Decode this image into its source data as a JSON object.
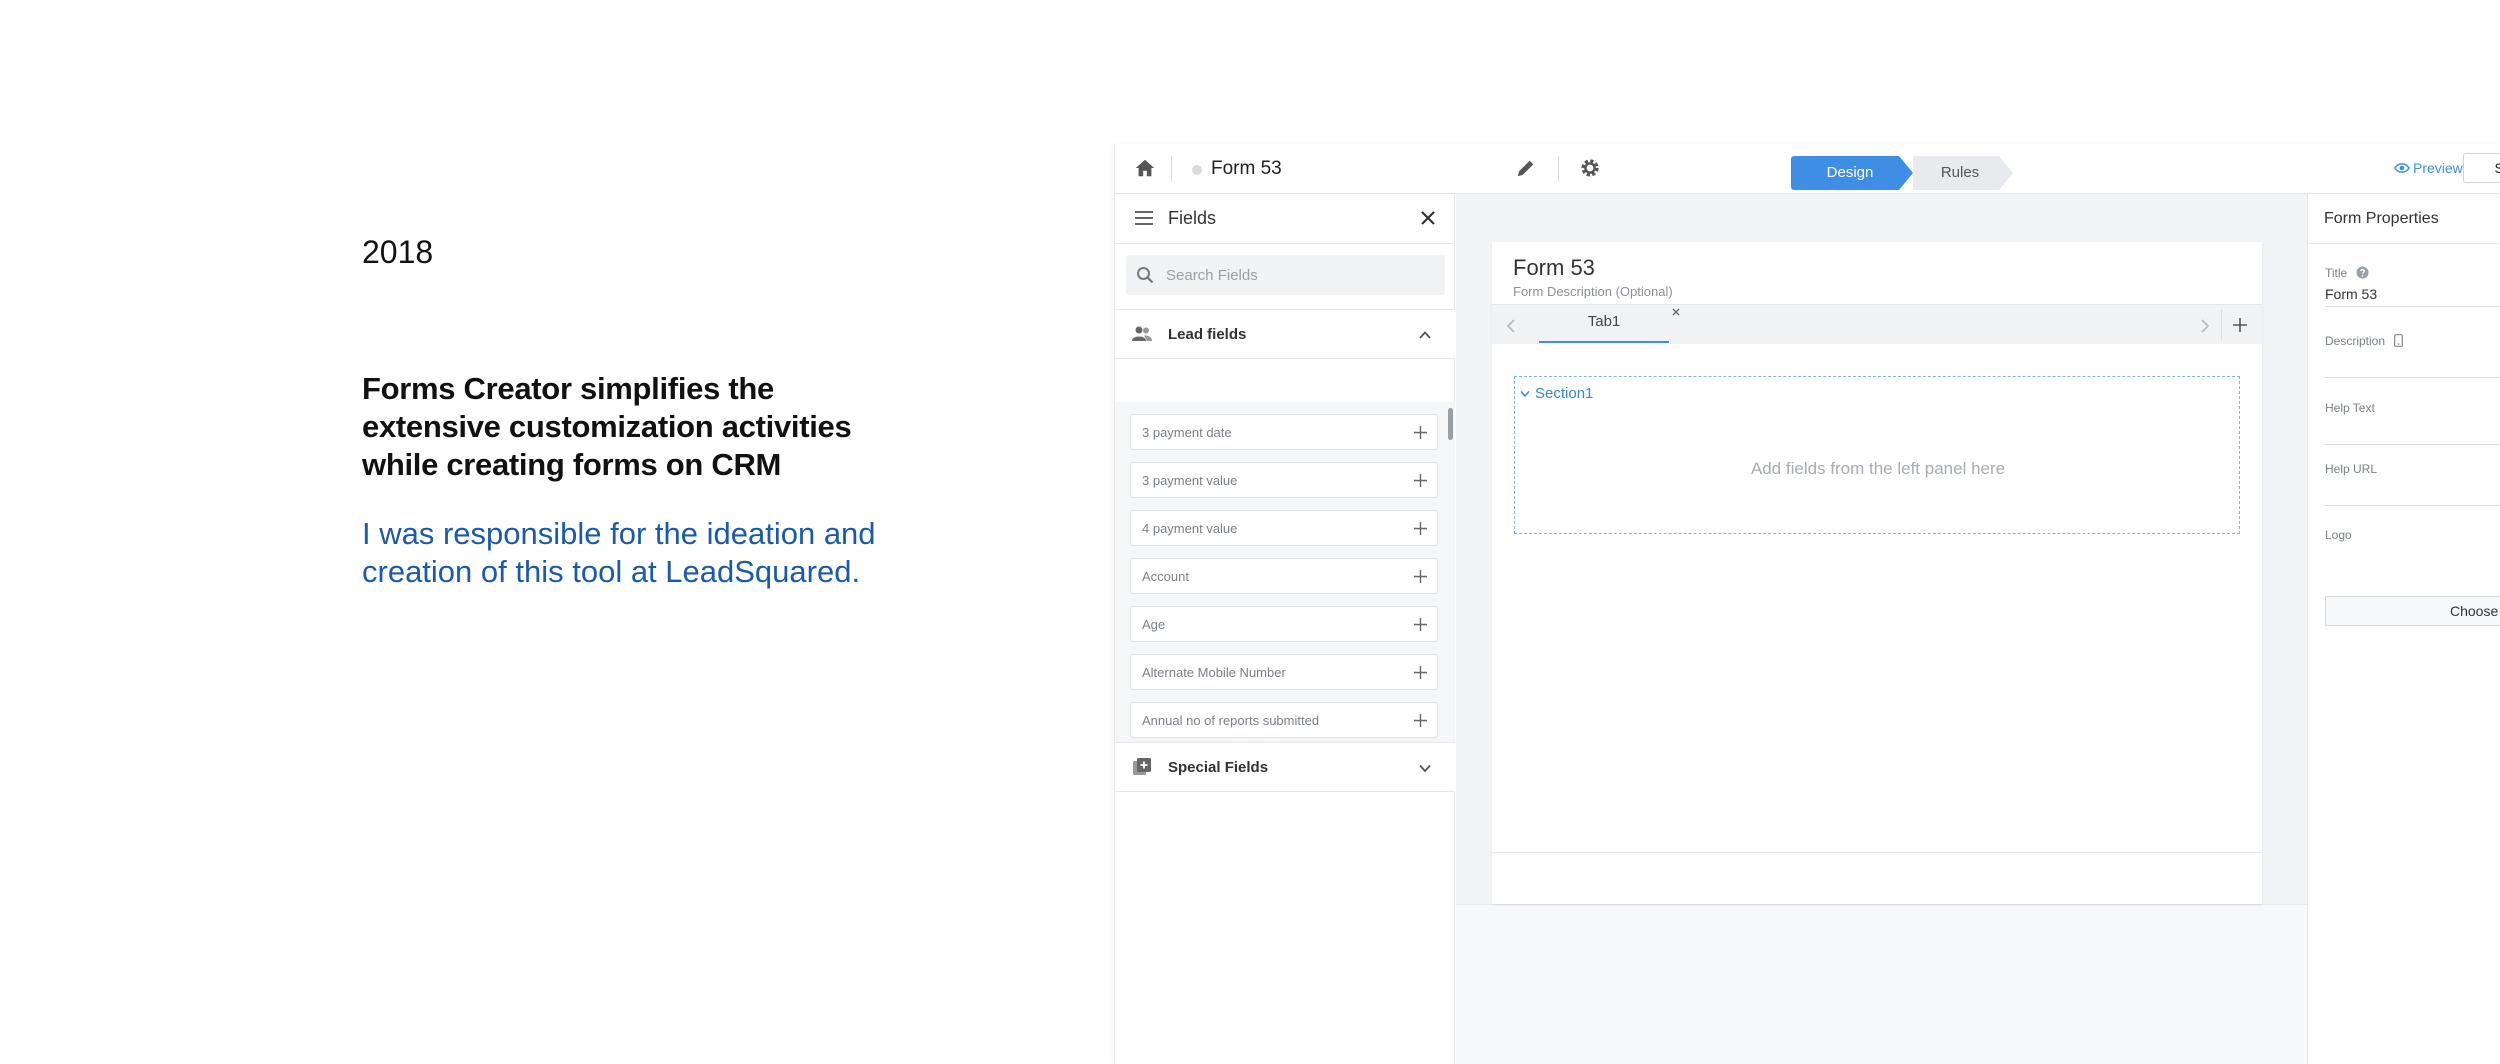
{
  "caption": {
    "year": "2018",
    "headline": "Forms Creator simplifies the extensive customization activities while creating forms on CRM",
    "subline": "I was responsible for the ideation and creation of this tool at LeadSquared."
  },
  "topbar": {
    "form_name": "Form 53",
    "steps": {
      "design": "Design",
      "rules": "Rules"
    },
    "preview_label": "Preview",
    "save_label": "Save"
  },
  "fields_panel": {
    "title": "Fields",
    "search_placeholder": "Search Fields",
    "lead_group_label": "Lead fields",
    "special_group_label": "Special Fields",
    "lead_fields": [
      "3 payment date",
      "3 payment value",
      "4 payment value",
      "Account",
      "Age",
      "Alternate Mobile Number",
      "Annual no of reports submitted"
    ]
  },
  "canvas": {
    "form_title": "Form 53",
    "form_description": "Form Description (Optional)",
    "tab_label": "Tab1",
    "section_title": "Section1",
    "section_hint": "Add fields from the left panel here"
  },
  "properties": {
    "title": "Form Properties",
    "title_label": "Title",
    "title_value": "Form 53",
    "description_label": "Description",
    "help_text_label": "Help Text",
    "help_url_label": "Help URL",
    "logo_label": "Logo",
    "choose_label": "Choose f"
  },
  "colors": {
    "accent": "#3f8ee6",
    "caption_blue": "#1a5aad",
    "section_border": "#7fb7d6"
  }
}
